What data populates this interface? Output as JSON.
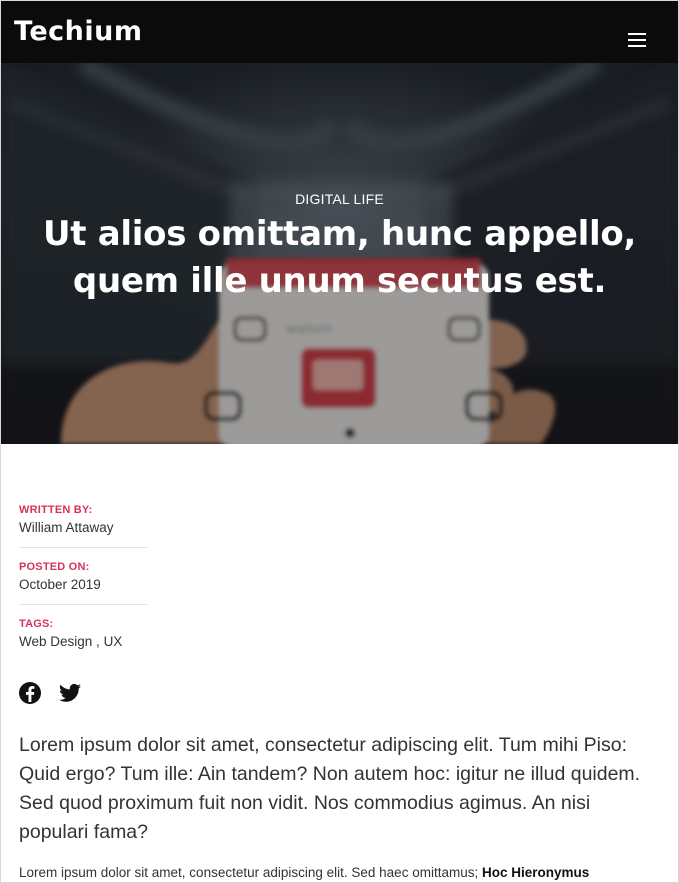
{
  "header": {
    "logo": "Techium",
    "menu_icon": "hamburger-menu-icon"
  },
  "hero": {
    "category": "DIGITAL LIFE",
    "title": "Ut alios omittam, hunc appello, quem ille unum secutus est.",
    "image_text": "wallum"
  },
  "meta": {
    "written_by_label": "WRITTEN BY:",
    "author": "William Attaway",
    "posted_on_label": "POSTED ON:",
    "date": "October 2019",
    "tags_label": "TAGS:",
    "tags": [
      "Web Design",
      "UX"
    ],
    "tag_separator": " , "
  },
  "social": {
    "icons": [
      "facebook-icon",
      "twitter-icon"
    ]
  },
  "article": {
    "lead": "Lorem ipsum dolor sit amet, consectetur adipiscing elit. Tum mihi Piso: Quid ergo? Tum ille: Ain tandem? Non autem hoc: igitur ne illud quidem. Sed quod proximum fuit non vidit. Nos commodius agimus. An nisi populari fama?",
    "para_start": "Lorem ipsum dolor sit amet, consectetur adipiscing elit. Sed haec omittamus; ",
    "para_bold": "Hoc Hieronymus"
  },
  "colors": {
    "header_bg": "#0b0b0b",
    "accent": "#d6335a",
    "text": "#333333"
  }
}
